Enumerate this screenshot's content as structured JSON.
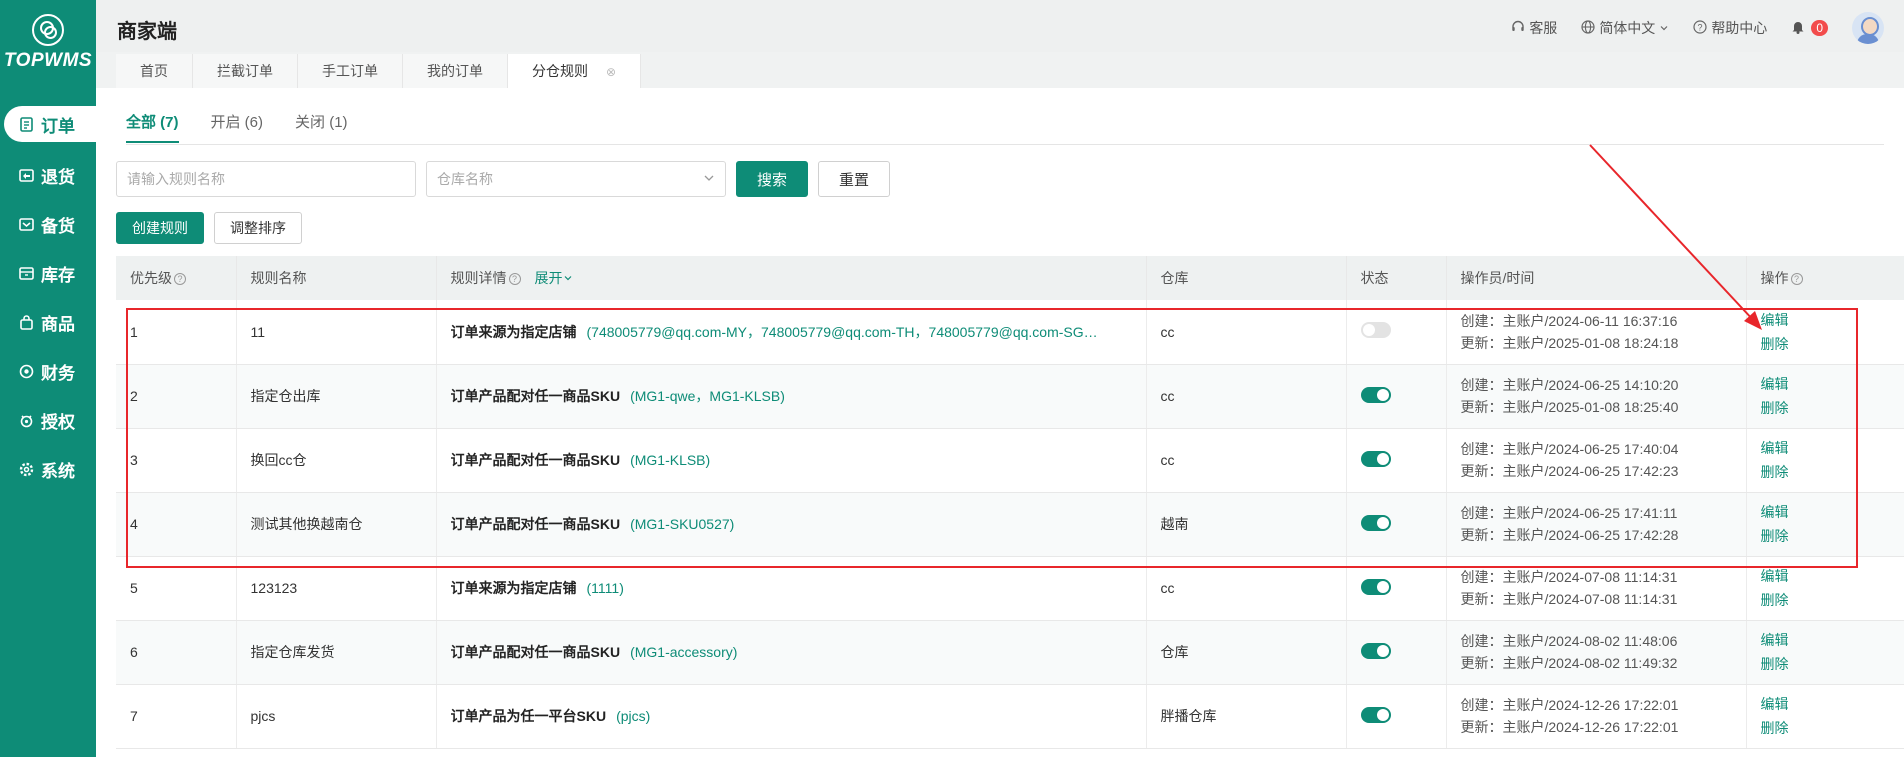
{
  "sidebar": {
    "logo_text": "TOPWMS",
    "items": [
      {
        "label": "订单",
        "icon": "order-icon"
      },
      {
        "label": "退货",
        "icon": "return-icon"
      },
      {
        "label": "备货",
        "icon": "stock-icon"
      },
      {
        "label": "库存",
        "icon": "inventory-icon"
      },
      {
        "label": "商品",
        "icon": "goods-icon"
      },
      {
        "label": "财务",
        "icon": "finance-icon"
      },
      {
        "label": "授权",
        "icon": "auth-icon"
      },
      {
        "label": "系统",
        "icon": "system-icon"
      }
    ]
  },
  "header": {
    "title": "商家端",
    "service": "客服",
    "language": "简体中文",
    "help": "帮助中心",
    "notifications": "0"
  },
  "page_tabs": [
    "首页",
    "拦截订单",
    "手工订单",
    "我的订单",
    "分仓规则"
  ],
  "filter_tabs": [
    "全部 (7)",
    "开启 (6)",
    "关闭 (1)"
  ],
  "search": {
    "name_placeholder": "请输入规则名称",
    "warehouse_placeholder": "仓库名称",
    "search_label": "搜索",
    "reset_label": "重置"
  },
  "actions": {
    "create_label": "创建规则",
    "sort_label": "调整排序"
  },
  "table": {
    "headers": {
      "priority": "优先级",
      "name": "规则名称",
      "detail": "规则详情",
      "expand": "展开",
      "warehouse": "仓库",
      "status": "状态",
      "operator": "操作员/时间",
      "ops": "操作"
    },
    "edit_label": "编辑",
    "delete_label": "删除",
    "rows": [
      {
        "priority": "1",
        "name": "11",
        "detail_key": "订单来源为指定店铺",
        "detail_val": "(748005779@qq.com-MY，748005779@qq.com-TH，748005779@qq.com-SG…",
        "warehouse": "cc",
        "enabled": false,
        "created": "创建：主账户/2024-06-11 16:37:16",
        "updated": "更新：主账户/2025-01-08 18:24:18"
      },
      {
        "priority": "2",
        "name": "指定仓出库",
        "detail_key": "订单产品配对任一商品SKU",
        "detail_val": "(MG1-qwe，MG1-KLSB)",
        "warehouse": "cc",
        "enabled": true,
        "created": "创建：主账户/2024-06-25 14:10:20",
        "updated": "更新：主账户/2025-01-08 18:25:40"
      },
      {
        "priority": "3",
        "name": "换回cc仓",
        "detail_key": "订单产品配对任一商品SKU",
        "detail_val": "(MG1-KLSB)",
        "warehouse": "cc",
        "enabled": true,
        "created": "创建：主账户/2024-06-25 17:40:04",
        "updated": "更新：主账户/2024-06-25 17:42:23"
      },
      {
        "priority": "4",
        "name": "测试其他换越南仓",
        "detail_key": "订单产品配对任一商品SKU",
        "detail_val": "(MG1-SKU0527)",
        "warehouse": "越南",
        "enabled": true,
        "created": "创建：主账户/2024-06-25 17:41:11",
        "updated": "更新：主账户/2024-06-25 17:42:28"
      },
      {
        "priority": "5",
        "name": "123123",
        "detail_key": "订单来源为指定店铺",
        "detail_val": "(1111)",
        "warehouse": "cc",
        "enabled": true,
        "created": "创建：主账户/2024-07-08 11:14:31",
        "updated": "更新：主账户/2024-07-08 11:14:31"
      },
      {
        "priority": "6",
        "name": "指定仓库发货",
        "detail_key": "订单产品配对任一商品SKU",
        "detail_val": "(MG1-accessory)",
        "warehouse": "仓库",
        "enabled": true,
        "created": "创建：主账户/2024-08-02 11:48:06",
        "updated": "更新：主账户/2024-08-02 11:49:32"
      },
      {
        "priority": "7",
        "name": "pjcs",
        "detail_key": "订单产品为任一平台SKU",
        "detail_val": "(pjcs)",
        "warehouse": "胖播仓库",
        "enabled": true,
        "created": "创建：主账户/2024-12-26 17:22:01",
        "updated": "更新：主账户/2024-12-26 17:22:01"
      }
    ]
  },
  "colors": {
    "brand": "#0e8c77",
    "annotation": "#e8262b"
  }
}
